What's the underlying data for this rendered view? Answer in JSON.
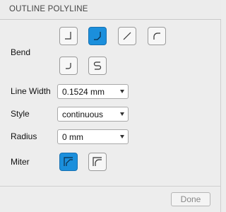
{
  "header": {
    "title": "OUTLINE POLYLINE"
  },
  "bend": {
    "label": "Bend",
    "options": [
      {
        "icon": "bend-90-icon",
        "selected": false
      },
      {
        "icon": "bend-45-corner-icon",
        "selected": true
      },
      {
        "icon": "bend-diagonal-icon",
        "selected": false
      },
      {
        "icon": "bend-arc-icon",
        "selected": false
      },
      {
        "icon": "bend-round-corner-icon",
        "selected": false
      },
      {
        "icon": "bend-s-curve-icon",
        "selected": false
      }
    ]
  },
  "line_width": {
    "label": "Line Width",
    "value": "0.1524 mm"
  },
  "style": {
    "label": "Style",
    "value": "continuous"
  },
  "radius": {
    "label": "Radius",
    "value": "0 mm"
  },
  "miter": {
    "label": "Miter",
    "options": [
      {
        "icon": "miter-sharp-icon",
        "selected": true
      },
      {
        "icon": "miter-round-icon",
        "selected": false
      }
    ]
  },
  "footer": {
    "done_label": "Done"
  },
  "colors": {
    "accent": "#1b8fdc",
    "panel_bg": "#ededed"
  }
}
